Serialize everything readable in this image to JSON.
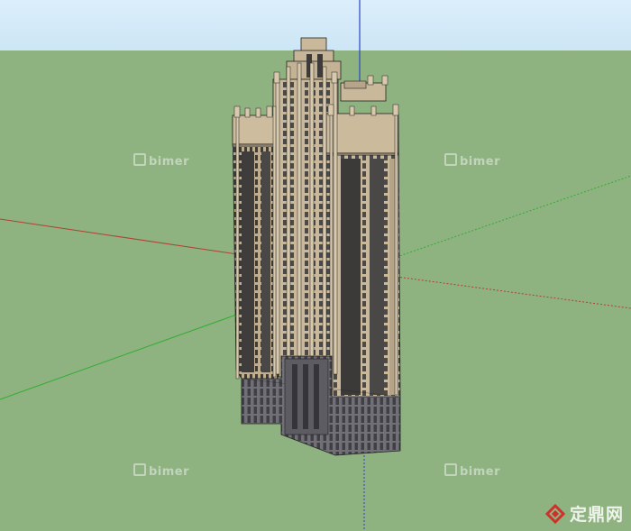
{
  "watermarks": {
    "tl": "bimer",
    "tr": "bimer",
    "bl": "bimer",
    "br": "bimer"
  },
  "corner_brand": "定鼎网",
  "colors": {
    "sky": "#d6ecf8",
    "ground": "#8fb281",
    "axis_red": "#b0412f",
    "axis_green": "#2fae2f",
    "axis_blue": "#2a44c8",
    "facade": "#c9b89a",
    "base": "#6e6e74"
  }
}
